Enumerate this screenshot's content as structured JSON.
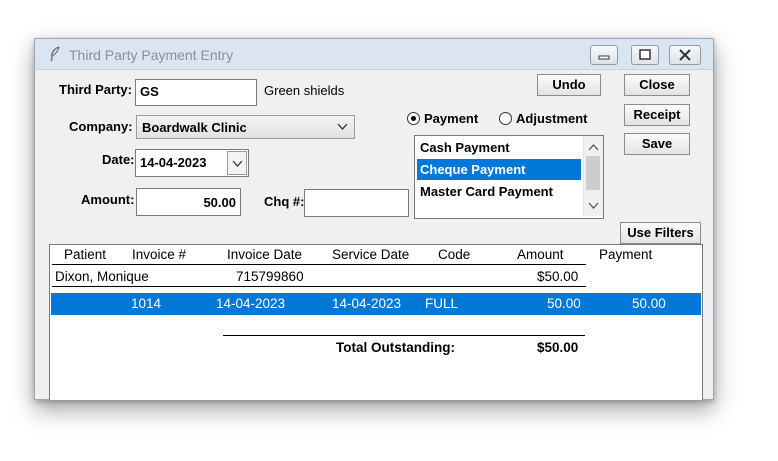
{
  "window": {
    "title": "Third Party Payment Entry"
  },
  "form": {
    "third_party_label": "Third Party:",
    "third_party_value": "GS",
    "third_party_name": "Green shields",
    "company_label": "Company:",
    "company_value": "Boardwalk Clinic",
    "date_label": "Date:",
    "date_value": "14-04-2023",
    "amount_label": "Amount:",
    "amount_value": "50.00",
    "chq_label": "Chq #:",
    "chq_value": ""
  },
  "buttons": {
    "undo": "Undo",
    "close": "Close",
    "receipt": "Receipt",
    "save": "Save",
    "use_filters": "Use Filters"
  },
  "radios": {
    "payment": "Payment",
    "adjustment": "Adjustment",
    "selected": "payment"
  },
  "payment_types": {
    "items": [
      "Cash Payment",
      "Cheque Payment",
      "Master Card Payment"
    ],
    "selected_index": 1
  },
  "grid": {
    "headers": [
      "Patient",
      "Invoice #",
      "Invoice Date",
      "Service Date",
      "Code",
      "Amount",
      "Payment"
    ],
    "patient_row": {
      "name": "Dixon, Monique",
      "invoice_date": "715799860",
      "amount": "$50.00"
    },
    "detail_row": {
      "invoice": "1014",
      "invoice_date": "14-04-2023",
      "service_date": "14-04-2023",
      "code": "FULL",
      "amount": "50.00",
      "payment": "50.00"
    },
    "total_label": "Total Outstanding:",
    "total_value": "$50.00"
  },
  "colors": {
    "selection": "#0078d7",
    "titlebar": "#dbe5f1"
  }
}
